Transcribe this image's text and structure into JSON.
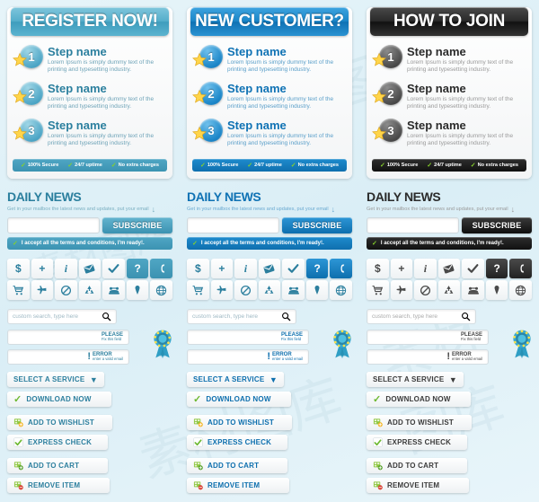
{
  "columns": [
    {
      "theme": "theme-a",
      "panel": {
        "header": "REGISTER NOW!",
        "steps": [
          {
            "num": "1",
            "title": "Step name",
            "desc": "Lorem Ipsum is simply dummy text of the printing and typesetting industry."
          },
          {
            "num": "2",
            "title": "Step name",
            "desc": "Lorem Ipsum is simply dummy text of the printing and typesetting industry."
          },
          {
            "num": "3",
            "title": "Step name",
            "desc": "Lorem Ipsum is simply dummy text of the printing and typesetting industry."
          }
        ],
        "trust": [
          "100% Secure",
          "24/7 uptime",
          "No extra charges"
        ]
      },
      "news": {
        "title": "DAILY NEWS",
        "subtitle": "Get in your mailbox the latest news and updates,  put your email",
        "input_value": "",
        "input_placeholder": "",
        "subscribe_label": "SUBSCRIBE",
        "accept_label": "I accept all the terms and conditions, I'm ready!."
      },
      "search": {
        "placeholder": "custom search, type here",
        "value": ""
      },
      "validation": {
        "please_title": "PLEASE",
        "please_sub": "Fix this field",
        "error_title": "ERROR",
        "error_sub": "enter a valid email"
      },
      "buttons": {
        "select_service": "SELECT A SERVICE",
        "download_now": "DOWNLOAD NOW",
        "add_to_wishlist": "ADD TO WISHLIST",
        "express_check": "EXPRESS CHECK",
        "add_to_cart": "ADD TO CART",
        "remove_item": "REMOVE ITEM"
      }
    },
    {
      "theme": "theme-b",
      "panel": {
        "header": "NEW CUSTOMER?",
        "steps": [
          {
            "num": "1",
            "title": "Step name",
            "desc": "Lorem Ipsum is simply dummy text of the printing and typesetting industry."
          },
          {
            "num": "2",
            "title": "Step name",
            "desc": "Lorem Ipsum is simply dummy text of the printing and typesetting industry."
          },
          {
            "num": "3",
            "title": "Step name",
            "desc": "Lorem Ipsum is simply dummy text of the printing and typesetting industry."
          }
        ],
        "trust": [
          "100% Secure",
          "24/7 uptime",
          "No extra charges"
        ]
      },
      "news": {
        "title": "DAILY NEWS",
        "subtitle": "Get in your mailbox the latest news and updates,  put your email",
        "input_value": "",
        "input_placeholder": "",
        "subscribe_label": "SUBSCRIBE",
        "accept_label": "I accept all the terms and conditions, I'm ready!."
      },
      "search": {
        "placeholder": "custom search, type here",
        "value": ""
      },
      "validation": {
        "please_title": "PLEASE",
        "please_sub": "Fix this field",
        "error_title": "ERROR",
        "error_sub": "enter a valid email"
      },
      "buttons": {
        "select_service": "SELECT A SERVICE",
        "download_now": "DOWNLOAD NOW",
        "add_to_wishlist": "ADD TO WISHLIST",
        "express_check": "EXPRESS CHECK",
        "add_to_cart": "ADD TO CART",
        "remove_item": "REMOVE ITEM"
      }
    },
    {
      "theme": "theme-c",
      "panel": {
        "header": "HOW TO JOIN",
        "steps": [
          {
            "num": "1",
            "title": "Step name",
            "desc": "Lorem Ipsum is simply dummy text of the printing and typesetting industry."
          },
          {
            "num": "2",
            "title": "Step name",
            "desc": "Lorem Ipsum is simply dummy text of the printing and typesetting industry."
          },
          {
            "num": "3",
            "title": "Step name",
            "desc": "Lorem Ipsum is simply dummy text of the printing and typesetting industry."
          }
        ],
        "trust": [
          "100% Secure",
          "24/7 uptime",
          "No extra charges"
        ]
      },
      "news": {
        "title": "DAILY NEWS",
        "subtitle": "Get in your mailbox the latest news and updates,  put your email",
        "input_value": "",
        "input_placeholder": "",
        "subscribe_label": "SUBSCRIBE",
        "accept_label": "I accept all the terms and conditions, I'm ready!."
      },
      "search": {
        "placeholder": "custom search, type here",
        "value": ""
      },
      "validation": {
        "please_title": "PLEASE",
        "please_sub": "Fix this field",
        "error_title": "ERROR",
        "error_sub": "enter a valid email"
      },
      "buttons": {
        "select_service": "SELECT A SERVICE",
        "download_now": "DOWNLOAD NOW",
        "add_to_wishlist": "ADD TO WISHLIST",
        "express_check": "EXPRESS CHECK",
        "add_to_cart": "ADD TO CART",
        "remove_item": "REMOVE ITEM"
      }
    }
  ],
  "icons": {
    "row1": [
      "dollar-icon",
      "plus-icon",
      "info-icon",
      "envelope-icon",
      "check-icon",
      "question-icon",
      "phone-handset-icon"
    ],
    "row1_glyphs": [
      "$",
      "+",
      "i",
      "envelope",
      "check",
      "?",
      "handset"
    ],
    "row2": [
      "shopping-cart-icon",
      "airplane-icon",
      "no-entry-icon",
      "recycle-icon",
      "telephone-icon",
      "map-pin-icon",
      "globe-icon"
    ],
    "row2_glyphs": [
      "cart",
      "plane",
      "noentry",
      "recycle",
      "telephone",
      "pin",
      "globe"
    ]
  },
  "colors": {
    "page_bg": "#dff1f7",
    "theme_a_accent": "#4fa6c4",
    "theme_b_accent": "#0f72b4",
    "theme_c_accent": "#1a1a1a",
    "green": "#6cb830",
    "star_yellow": "#ffd54a",
    "red": "#d8392b"
  },
  "watermark": {
    "text": "素材图库"
  }
}
